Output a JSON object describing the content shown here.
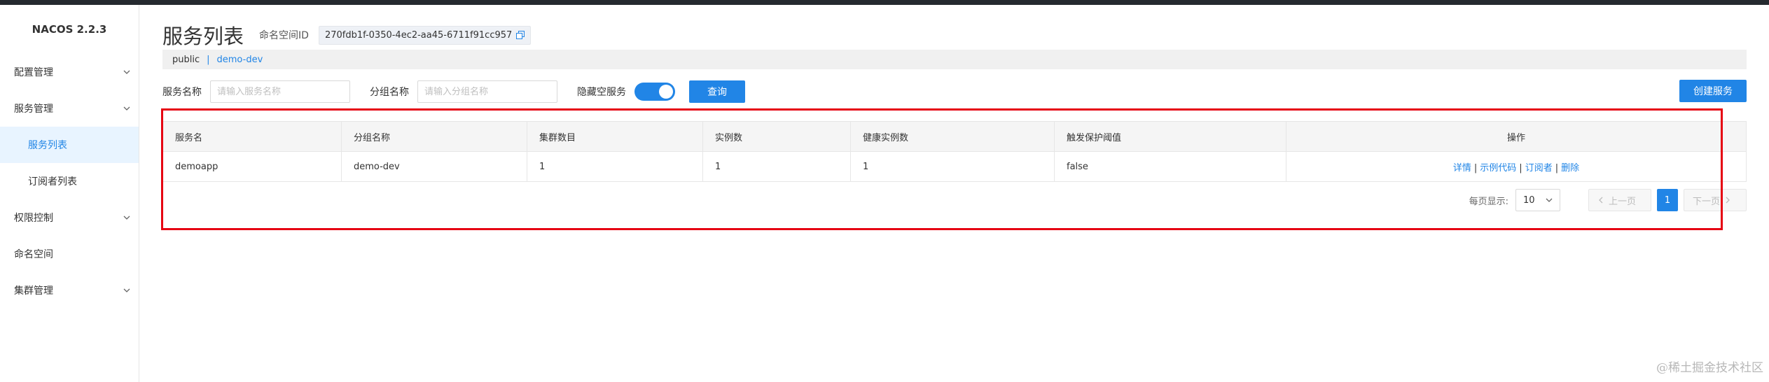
{
  "app": {
    "brand": "NACOS 2.2.3"
  },
  "sidebar": {
    "items": [
      {
        "label": "配置管理",
        "expandable": true
      },
      {
        "label": "服务管理",
        "expandable": true
      },
      {
        "label": "服务列表",
        "sub": true,
        "active": true
      },
      {
        "label": "订阅者列表",
        "sub": true
      },
      {
        "label": "权限控制",
        "expandable": true
      },
      {
        "label": "命名空间",
        "expandable": false
      },
      {
        "label": "集群管理",
        "expandable": true
      }
    ]
  },
  "header": {
    "title": "服务列表",
    "namespace_label": "命名空间ID",
    "namespace_id": "270fdb1f-0350-4ec2-aa45-6711f91cc957",
    "copy_icon": "copy-icon"
  },
  "namespaces": {
    "items": [
      "public",
      "demo-dev"
    ],
    "separator": "|",
    "current": "demo-dev"
  },
  "filters": {
    "service_name_label": "服务名称",
    "service_name_placeholder": "请输入服务名称",
    "group_name_label": "分组名称",
    "group_name_placeholder": "请输入分组名称",
    "hide_empty_label": "隐藏空服务",
    "hide_empty_on": true,
    "query_button": "查询",
    "create_button": "创建服务"
  },
  "table": {
    "columns": [
      "服务名",
      "分组名称",
      "集群数目",
      "实例数",
      "健康实例数",
      "触发保护阈值",
      "操作"
    ],
    "rows": [
      {
        "service": "demoapp",
        "group": "demo-dev",
        "clusters": "1",
        "instances": "1",
        "healthy": "1",
        "threshold": "false",
        "actions": [
          "详情",
          "示例代码",
          "订阅者",
          "删除"
        ]
      }
    ]
  },
  "pagination": {
    "page_size_label": "每页显示:",
    "page_size": "10",
    "prev": "上一页",
    "next": "下一页",
    "current_page": "1"
  },
  "watermark": "@稀土掘金技术社区",
  "colors": {
    "accent": "#2185e6",
    "highlight": "#e60012",
    "topbar": "#252a2f"
  }
}
